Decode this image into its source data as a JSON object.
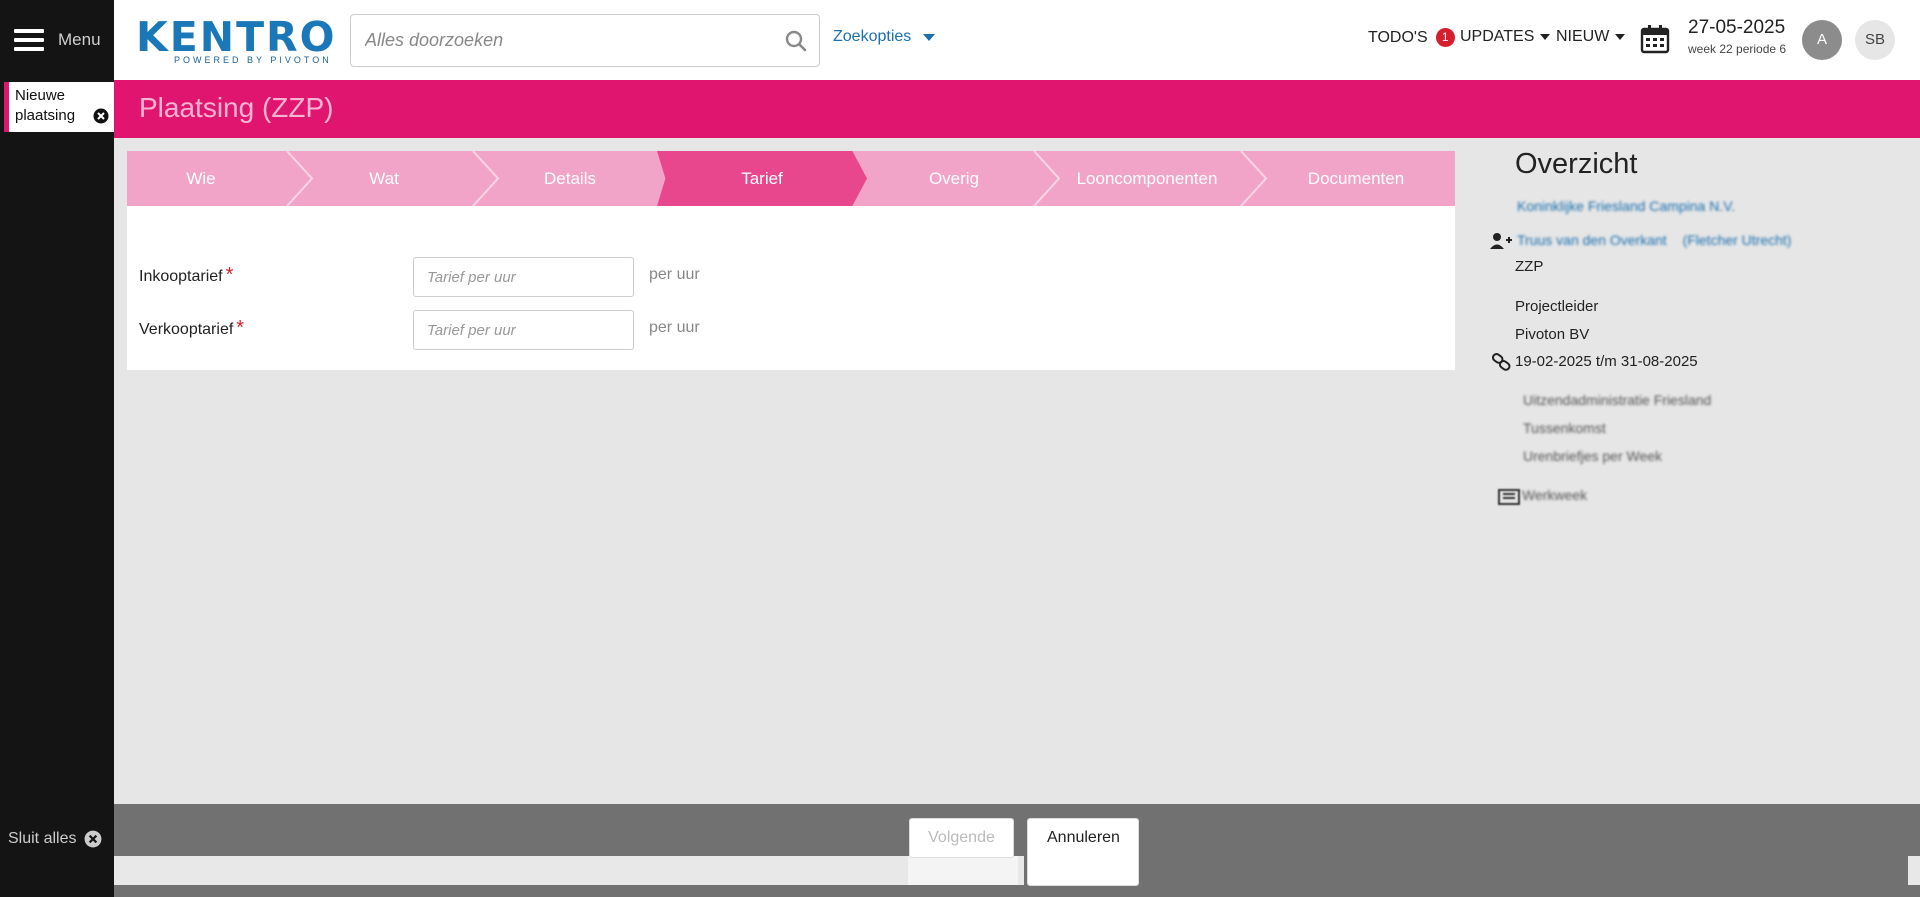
{
  "header": {
    "menu_label": "Menu",
    "logo_text": "KENTRO",
    "logo_sub": "POWERED BY PIVOTON",
    "search_placeholder": "Alles doorzoeken",
    "zoekopties": "Zoekopties",
    "todos_label": "TODO'S",
    "todos_count": "1",
    "updates_label": "UPDATES",
    "nieuw_label": "NIEUW",
    "date": "27-05-2025",
    "week": "week 22 periode 6",
    "avatar_a": "A",
    "avatar_sb": "SB"
  },
  "sidebar": {
    "open_tab_line1": "Nieuwe",
    "open_tab_line2": "plaatsing",
    "sluit_alles": "Sluit alles"
  },
  "page": {
    "title": "Plaatsing (ZZP)"
  },
  "steps": [
    {
      "label": "Wie",
      "active": false
    },
    {
      "label": "Wat",
      "active": false
    },
    {
      "label": "Details",
      "active": false
    },
    {
      "label": "Tarief",
      "active": true
    },
    {
      "label": "Overig",
      "active": false
    },
    {
      "label": "Looncomponenten",
      "active": false
    },
    {
      "label": "Documenten",
      "active": false
    }
  ],
  "form": {
    "inkoop_label": "Inkooptarief",
    "verkoop_label": "Verkooptarief",
    "required_mark": "*",
    "placeholder": "Tarief per uur",
    "unit": "per uur"
  },
  "overzicht": {
    "title": "Overzicht",
    "company": "Koninklijke Friesland Campina N.V.",
    "person": "Truus van den Overkant",
    "person_note": "(Fletcher Utrecht)",
    "type": "ZZP",
    "role": "Projectleider",
    "employer": "Pivoton BV",
    "period": "19-02-2025 t/m 31-08-2025",
    "blur1": "Uitzendadministratie Friesland",
    "blur2": "Tussenkomst",
    "blur3": "Urenbriefjes per Week",
    "blur4": "Werkweek"
  },
  "footer": {
    "volgende": "Volgende",
    "annuleren": "Annuleren"
  },
  "colors": {
    "brand_pink": "#e0156f",
    "step_bg": "#f1a4c8",
    "step_active": "#e8478d",
    "link_blue": "#1a6fb0",
    "sidebar_dark": "#141414"
  }
}
